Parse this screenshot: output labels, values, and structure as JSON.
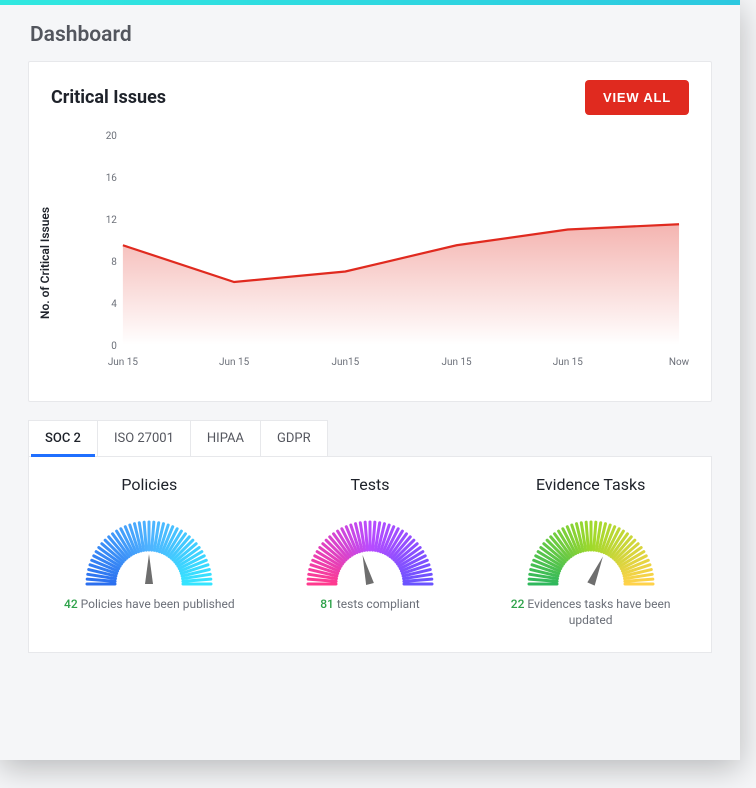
{
  "page_title": "Dashboard",
  "critical_issues": {
    "title": "Critical Issues",
    "view_all_label": "VIEW ALL"
  },
  "tabs": {
    "soc2": "SOC 2",
    "iso27001": "ISO 27001",
    "hipaa": "HIPAA",
    "gdpr": "GDPR"
  },
  "gauges": {
    "policies": {
      "title": "Policies",
      "count": "42",
      "text": " Policies have been published",
      "percent": 0.5
    },
    "tests": {
      "title": "Tests",
      "count": "81",
      "text": " tests compliant",
      "percent": 0.42
    },
    "evidence": {
      "title": "Evidence Tasks",
      "count": "22",
      "text": " Evidences tasks have been updated",
      "percent": 0.63
    }
  },
  "chart_data": {
    "type": "area",
    "ylabel": "No. of Critical Issues",
    "categories": [
      "Jun 15",
      "Jun 15",
      "Jun15",
      "Jun 15",
      "Jun 15",
      "Now"
    ],
    "values": [
      9.5,
      6,
      7,
      9.5,
      11,
      11.5
    ],
    "y_ticks": [
      0,
      4,
      8,
      12,
      16,
      20
    ],
    "ylim": [
      0,
      20
    ],
    "color": "#e02a1f"
  }
}
